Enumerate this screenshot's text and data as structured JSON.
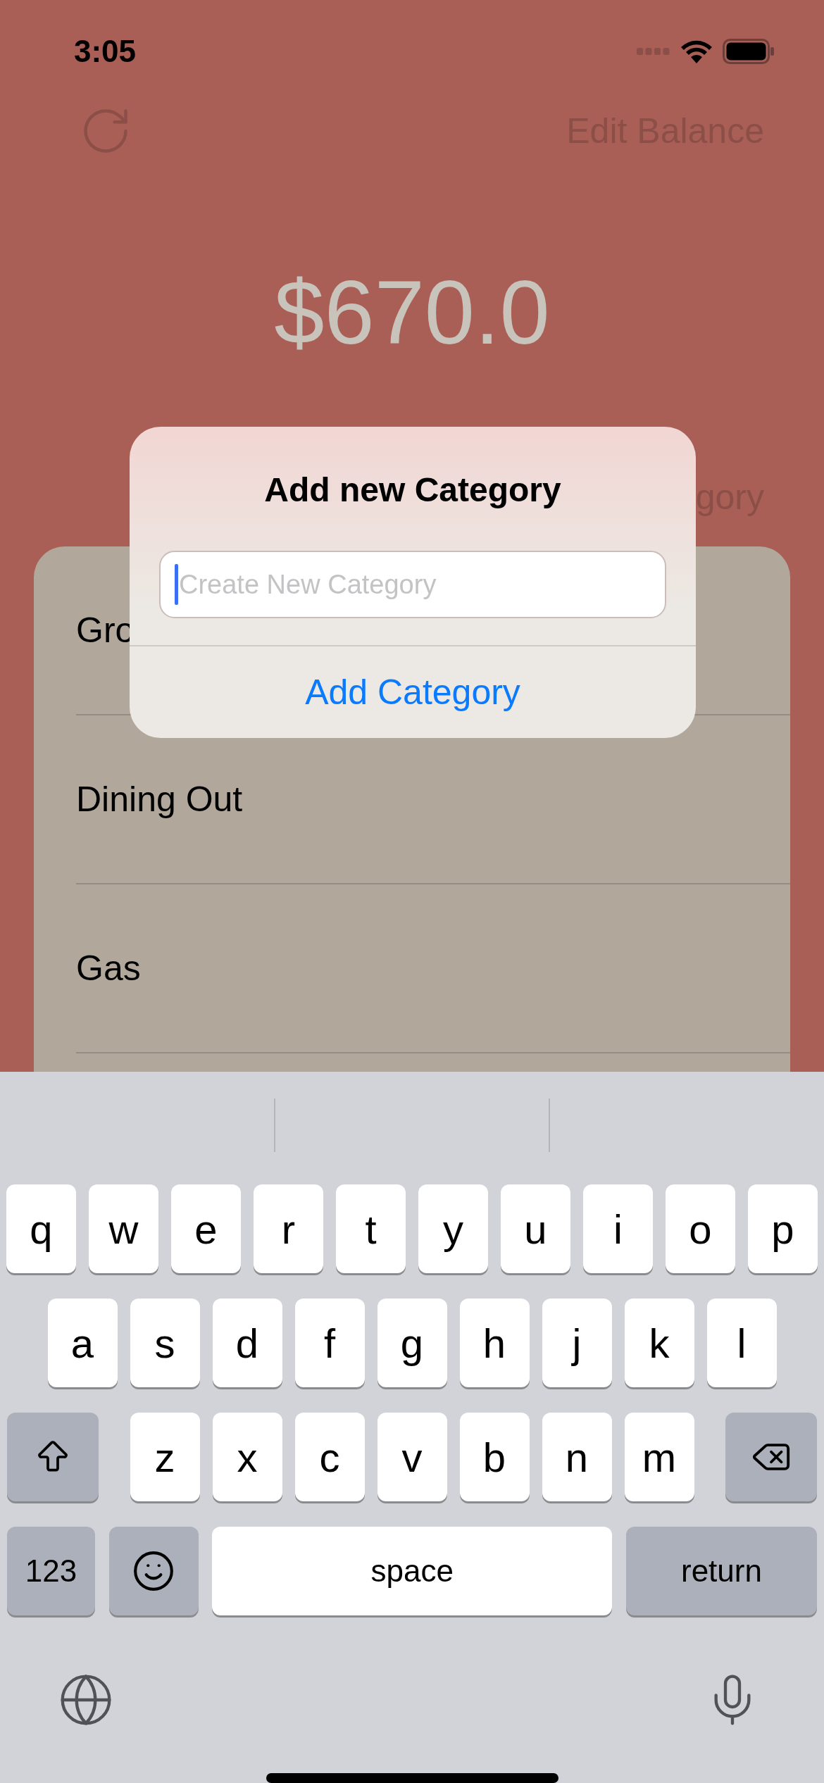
{
  "status_bar": {
    "time": "3:05"
  },
  "header": {
    "edit_button": "Edit Balance"
  },
  "balance": "$670.0",
  "add_category_link": "gory",
  "categories": [
    {
      "name": "Gro"
    },
    {
      "name": "Dining Out"
    },
    {
      "name": "Gas"
    }
  ],
  "dialog": {
    "title": "Add new Category",
    "input": {
      "placeholder": "Create New Category"
    },
    "button": "Add Category"
  },
  "keyboard": {
    "rows": [
      [
        {
          "kind": "letter",
          "label": "q"
        },
        {
          "kind": "letter",
          "label": "w"
        },
        {
          "kind": "letter",
          "label": "e"
        },
        {
          "kind": "letter",
          "label": "r"
        },
        {
          "kind": "letter",
          "label": "t"
        },
        {
          "kind": "letter",
          "label": "y"
        },
        {
          "kind": "letter",
          "label": "u"
        },
        {
          "kind": "letter",
          "label": "i"
        },
        {
          "kind": "letter",
          "label": "o"
        },
        {
          "kind": "letter",
          "label": "p"
        }
      ],
      [
        {
          "kind": "letter",
          "label": "a"
        },
        {
          "kind": "letter",
          "label": "s"
        },
        {
          "kind": "letter",
          "label": "d"
        },
        {
          "kind": "letter",
          "label": "f"
        },
        {
          "kind": "letter",
          "label": "g"
        },
        {
          "kind": "letter",
          "label": "h"
        },
        {
          "kind": "letter",
          "label": "j"
        },
        {
          "kind": "letter",
          "label": "k"
        },
        {
          "kind": "letter",
          "label": "l"
        }
      ],
      [
        {
          "kind": "shift"
        },
        {
          "kind": "letter",
          "label": "z"
        },
        {
          "kind": "letter",
          "label": "x"
        },
        {
          "kind": "letter",
          "label": "c"
        },
        {
          "kind": "letter",
          "label": "v"
        },
        {
          "kind": "letter",
          "label": "b"
        },
        {
          "kind": "letter",
          "label": "n"
        },
        {
          "kind": "letter",
          "label": "m"
        },
        {
          "kind": "delete"
        }
      ]
    ],
    "bottom_row": [
      {
        "kind": "mode",
        "label": "123"
      },
      {
        "kind": "emoji"
      },
      {
        "kind": "space",
        "label": "space"
      },
      {
        "kind": "return",
        "label": "return"
      }
    ]
  }
}
